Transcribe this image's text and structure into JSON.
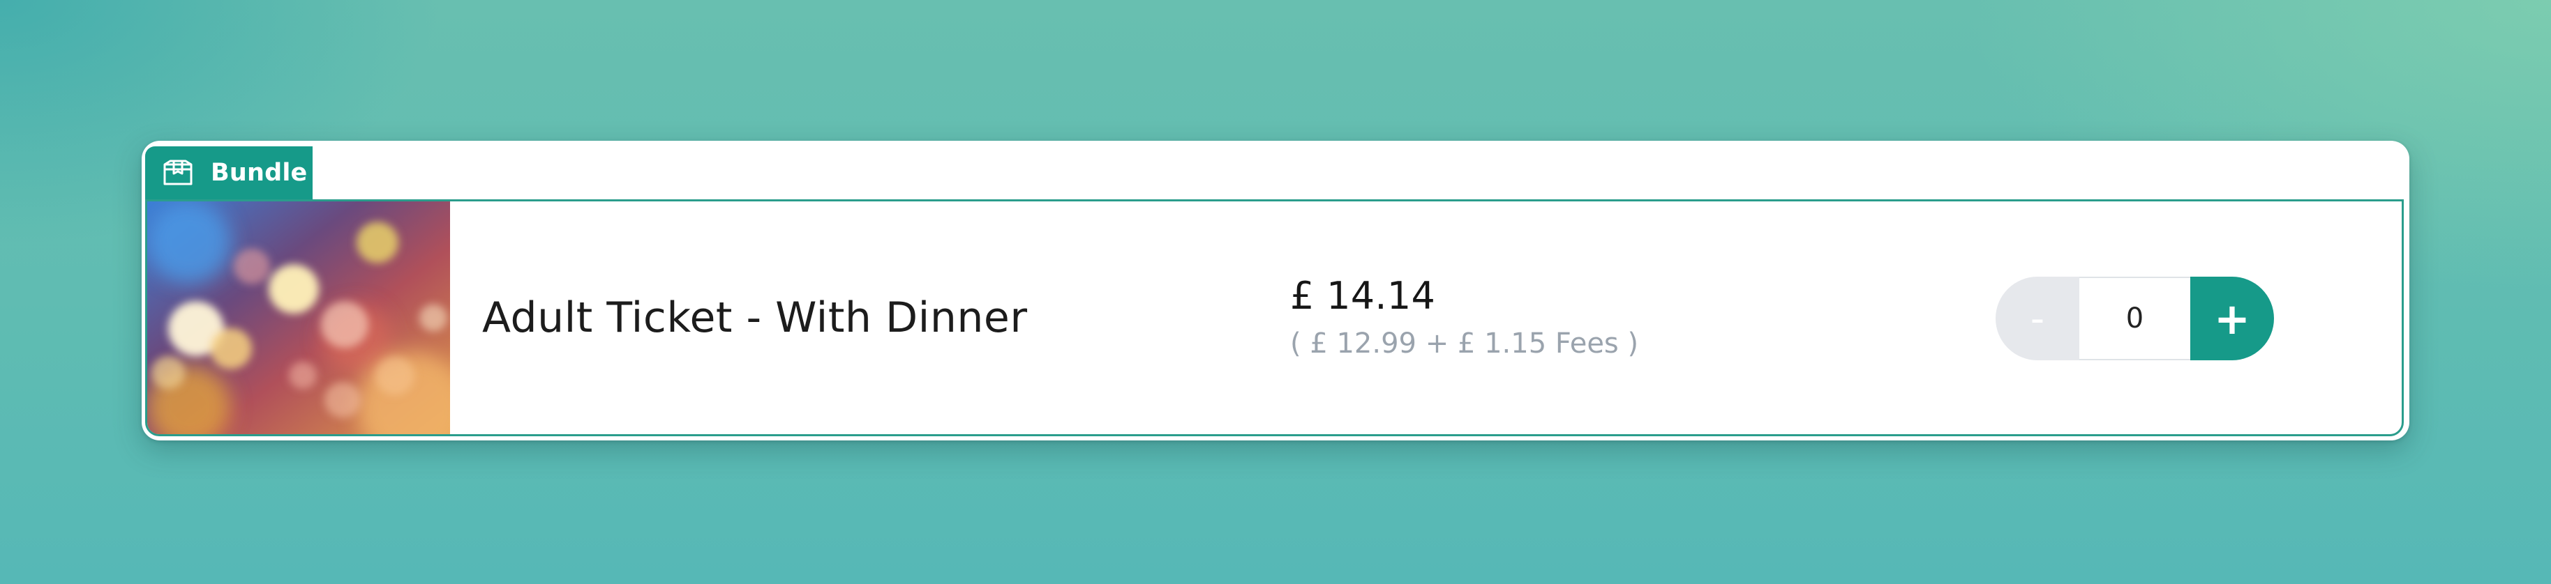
{
  "badge": {
    "label": "Bundle",
    "icon": "box-icon",
    "color": "#169a89"
  },
  "ticket": {
    "name": "Adult Ticket - With Dinner",
    "image": "bokeh-lights-image",
    "price_total": "£ 14.14",
    "price_breakdown": "( £ 12.99 + £ 1.15 Fees )",
    "quantity": {
      "decrement_label": "-",
      "value": "0",
      "increment_label": "+"
    }
  },
  "colors": {
    "accent": "#169a89",
    "muted_text": "#9aa3ad",
    "disabled_button": "#e6e8ec"
  }
}
